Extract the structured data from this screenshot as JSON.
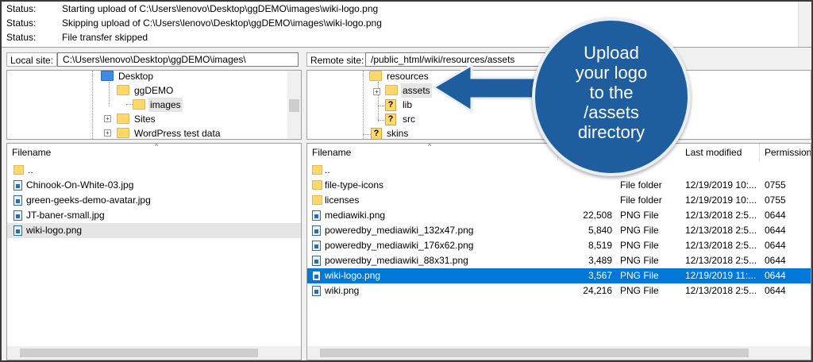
{
  "log": [
    {
      "label": "Status:",
      "message": "Starting upload of C:\\Users\\lenovo\\Desktop\\ggDEMO\\images\\wiki-logo.png"
    },
    {
      "label": "Status:",
      "message": "Skipping upload of C:\\Users\\lenovo\\Desktop\\ggDEMO\\images\\wiki-logo.png"
    },
    {
      "label": "Status:",
      "message": "File transfer skipped"
    }
  ],
  "local": {
    "label": "Local site:",
    "path": "C:\\Users\\lenovo\\Desktop\\ggDEMO\\images\\",
    "tree": [
      "Desktop",
      "ggDEMO",
      "images",
      "Sites",
      "WordPress test data"
    ],
    "header": "Filename",
    "files": [
      {
        "name": "..",
        "icon": "folder-icon"
      },
      {
        "name": "Chinook-On-White-03.jpg",
        "icon": "image-file-icon"
      },
      {
        "name": "green-geeks-demo-avatar.jpg",
        "icon": "image-file-icon"
      },
      {
        "name": "JT-baner-small.jpg",
        "icon": "image-file-icon"
      },
      {
        "name": "wiki-logo.png",
        "icon": "image-file-icon"
      }
    ]
  },
  "remote": {
    "label": "Remote site:",
    "path": "/public_html/wiki/resources/assets",
    "tree": [
      "resources",
      "assets",
      "lib",
      "src",
      "skins"
    ],
    "headers": {
      "filename": "Filename",
      "modified": "Last modified",
      "permissions": "Permissions"
    },
    "files": [
      {
        "name": "..",
        "size": "",
        "type": "",
        "modified": "",
        "perms": "",
        "icon": "folder-icon"
      },
      {
        "name": "file-type-icons",
        "size": "",
        "type": "File folder",
        "modified": "12/19/2019 10:...",
        "perms": "0755",
        "icon": "folder-icon"
      },
      {
        "name": "licenses",
        "size": "",
        "type": "File folder",
        "modified": "12/19/2019 10:...",
        "perms": "0755",
        "icon": "folder-icon"
      },
      {
        "name": "mediawiki.png",
        "size": "22,508",
        "type": "PNG File",
        "modified": "12/13/2018 2:5...",
        "perms": "0644",
        "icon": "image-file-icon"
      },
      {
        "name": "poweredby_mediawiki_132x47.png",
        "size": "5,840",
        "type": "PNG File",
        "modified": "12/13/2018 2:5...",
        "perms": "0644",
        "icon": "image-file-icon"
      },
      {
        "name": "poweredby_mediawiki_176x62.png",
        "size": "8,519",
        "type": "PNG File",
        "modified": "12/13/2018 2:5...",
        "perms": "0644",
        "icon": "image-file-icon"
      },
      {
        "name": "poweredby_mediawiki_88x31.png",
        "size": "3,489",
        "type": "PNG File",
        "modified": "12/13/2018 2:5...",
        "perms": "0644",
        "icon": "image-file-icon"
      },
      {
        "name": "wiki-logo.png",
        "size": "3,567",
        "type": "PNG File",
        "modified": "12/19/2019 11:...",
        "perms": "0644",
        "icon": "image-file-icon"
      },
      {
        "name": "wiki.png",
        "size": "24,216",
        "type": "PNG File",
        "modified": "12/13/2018 2:5...",
        "perms": "0644",
        "icon": "image-file-icon"
      }
    ]
  },
  "callout": {
    "lines": [
      "Upload",
      "your logo",
      "to the",
      "/assets",
      "directory"
    ],
    "color": "#1f5e9e"
  },
  "colors": {
    "selection": "#0078d7"
  }
}
